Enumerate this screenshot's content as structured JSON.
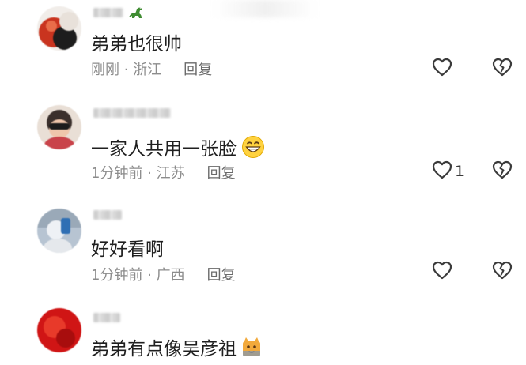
{
  "comments": [
    {
      "username": "",
      "text": "弟弟也很帅",
      "time": "刚刚",
      "location": "浙江",
      "meta": "刚刚 · 浙江",
      "reply_label": "回复",
      "likes": "",
      "avatar_color": "#b83a2c",
      "emoji": "dinosaur-icon"
    },
    {
      "username": "",
      "text": "一家人共用一张脸",
      "time": "1分钟前",
      "location": "江苏",
      "meta": "1分钟前 · 江苏",
      "reply_label": "回复",
      "likes": "1",
      "avatar_color": "#d9a589",
      "emoji": "grinning-face-icon"
    },
    {
      "username": "",
      "text": "好好看啊",
      "time": "1分钟前",
      "location": "广西",
      "meta": "1分钟前 · 广西",
      "reply_label": "回复",
      "likes": "",
      "avatar_color": "#8aa0b8"
    },
    {
      "username": "",
      "text": "弟弟有点像吴彦祖",
      "time": "",
      "location": "",
      "meta": "",
      "reply_label": "",
      "likes": "",
      "avatar_color": "#d01515",
      "emoji": "cat-icon"
    }
  ]
}
